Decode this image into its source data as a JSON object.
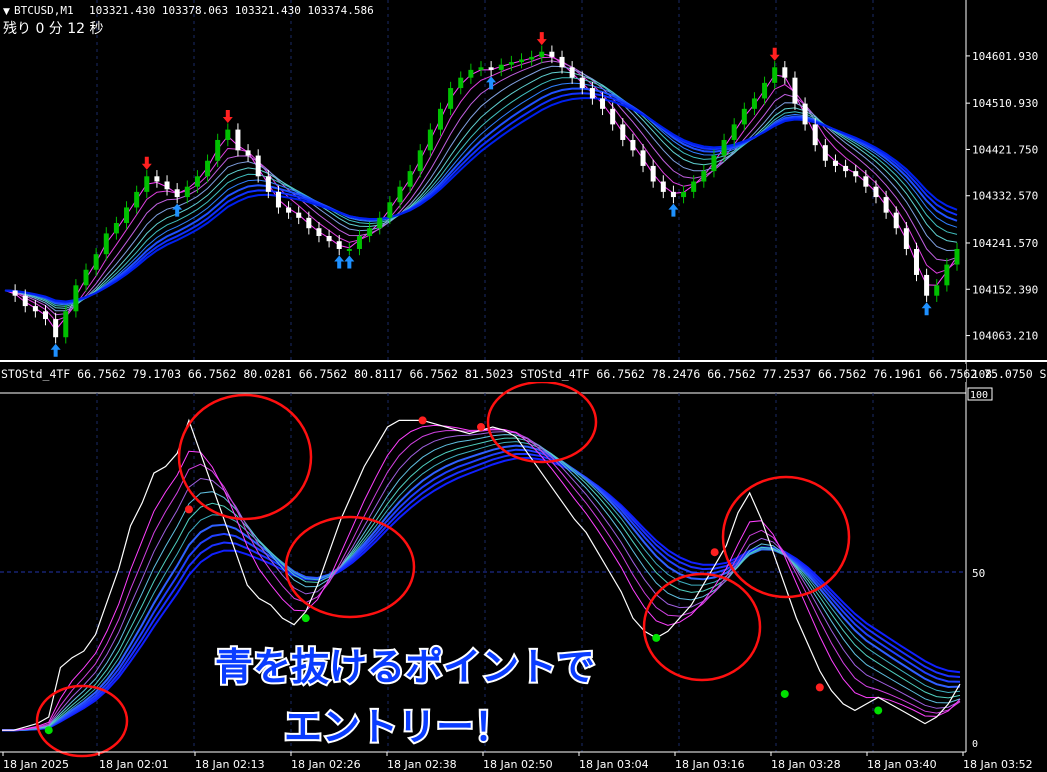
{
  "window": {
    "title": "BTCUSD,M1",
    "ohlc": "103321.430 103378.063 103321.430 103374.586",
    "countdown": "残り 0 分 12 秒"
  },
  "colors": {
    "background": "#000000",
    "bull_candle": "#00c000",
    "bear_candle": "#ffffff",
    "up_arrow": "#1e90ff",
    "down_arrow": "#ff2020",
    "grid": "#1a2a66",
    "signal_green": "#00e000",
    "signal_red": "#ff2020",
    "ellipse": "#ff1010",
    "caption_text": "#0a3cff"
  },
  "indicator": {
    "header": "STOStd_4TF 66.7562 79.1703 66.7562 80.0281 66.7562 80.8117 66.7562 81.5023   STOStd_4TF 66.7562 78.2476 66.7562 77.2537 66.7562 76.1961 66.7562 75.0750   S",
    "scale_max": "108",
    "scale_100": "100",
    "scale_50": "50",
    "scale_0": "0"
  },
  "caption": {
    "line1": "青を抜けるポイントで",
    "line2": "エントリー！"
  },
  "chart_data": {
    "type": "line",
    "price_axis_ticks": [
      "104601.930",
      "104510.930",
      "104421.750",
      "104332.570",
      "104241.570",
      "104152.390",
      "104063.210"
    ],
    "price_ylim": [
      104020,
      104700
    ],
    "time_axis_ticks": [
      "18 Jan 2025",
      "18 Jan 02:01",
      "18 Jan 02:13",
      "18 Jan 02:26",
      "18 Jan 02:38",
      "18 Jan 02:50",
      "18 Jan 03:04",
      "18 Jan 03:16",
      "18 Jan 03:28",
      "18 Jan 03:40",
      "18 Jan 03:52"
    ],
    "price_series": [
      104150,
      104140,
      104120,
      104110,
      104095,
      104060,
      104110,
      104160,
      104190,
      104220,
      104260,
      104280,
      104310,
      104340,
      104370,
      104360,
      104345,
      104330,
      104350,
      104370,
      104400,
      104440,
      104460,
      104420,
      104410,
      104370,
      104340,
      104310,
      104300,
      104290,
      104270,
      104255,
      104245,
      104230,
      104230,
      104255,
      104270,
      104290,
      104320,
      104350,
      104380,
      104420,
      104460,
      104500,
      104540,
      104560,
      104575,
      104580,
      104575,
      104585,
      104590,
      104595,
      104600,
      104610,
      104600,
      104580,
      104560,
      104540,
      104520,
      104500,
      104470,
      104440,
      104420,
      104390,
      104360,
      104340,
      104330,
      104340,
      104360,
      104380,
      104410,
      104440,
      104470,
      104500,
      104520,
      104550,
      104580,
      104560,
      104510,
      104470,
      104430,
      104400,
      104390,
      104380,
      104370,
      104350,
      104330,
      104300,
      104270,
      104230,
      104180,
      104140,
      104160,
      104200,
      104230
    ],
    "stoch_ylim": [
      0,
      108
    ],
    "stoch_series": [
      6,
      6,
      7,
      8,
      10,
      25,
      28,
      30,
      35,
      45,
      55,
      68,
      75,
      84,
      86,
      90,
      100,
      90,
      80,
      70,
      60,
      50,
      46,
      44,
      40,
      38,
      42,
      50,
      60,
      70,
      78,
      86,
      92,
      98,
      100,
      100,
      100,
      99,
      98,
      97,
      96,
      97,
      98,
      97,
      95,
      90,
      85,
      80,
      75,
      70,
      66,
      60,
      54,
      48,
      40,
      36,
      34,
      36,
      40,
      44,
      50,
      56,
      62,
      72,
      78,
      70,
      60,
      50,
      40,
      32,
      24,
      18,
      14,
      12,
      14,
      16,
      14,
      12,
      10,
      8,
      10,
      14,
      20
    ],
    "entry_points": [
      {
        "x_index": 4,
        "stoch": 6,
        "kind": "green"
      },
      {
        "x_index": 36,
        "stoch": 100,
        "kind": "red"
      },
      {
        "x_index": 41,
        "stoch": 98,
        "kind": "red"
      },
      {
        "x_index": 16,
        "stoch": 73,
        "kind": "red"
      },
      {
        "x_index": 26,
        "stoch": 40,
        "kind": "green"
      },
      {
        "x_index": 56,
        "stoch": 34,
        "kind": "green"
      },
      {
        "x_index": 61,
        "stoch": 60,
        "kind": "red"
      },
      {
        "x_index": 67,
        "stoch": 17,
        "kind": "green"
      },
      {
        "x_index": 70,
        "stoch": 19,
        "kind": "red"
      },
      {
        "x_index": 75,
        "stoch": 12,
        "kind": "green"
      }
    ]
  }
}
